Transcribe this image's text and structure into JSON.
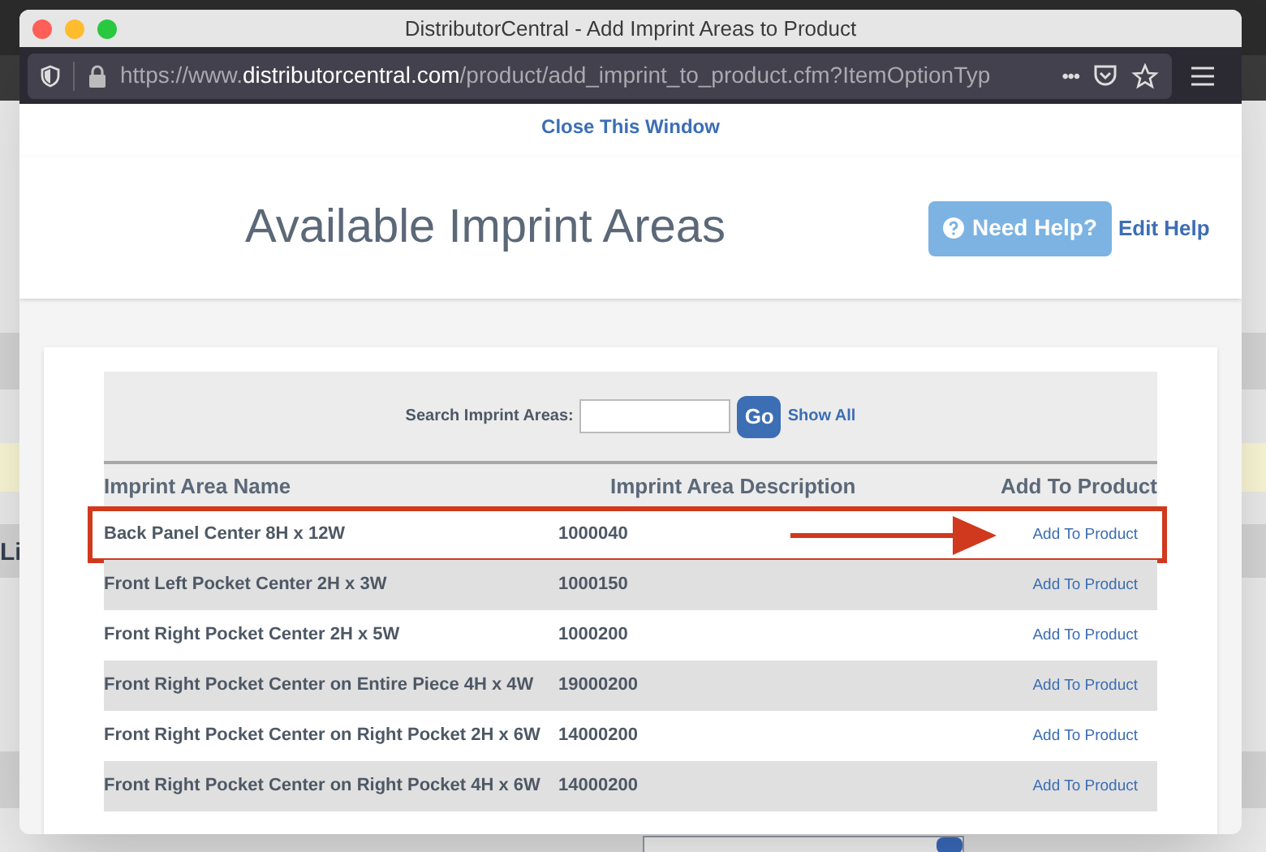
{
  "background_page": {
    "fragment": "Li"
  },
  "window": {
    "title": "DistributorCentral - Add Imprint Areas to Product"
  },
  "address_bar": {
    "url_prefix": "https://www.",
    "url_domain": "distributorcentral.com",
    "url_path": "/product/add_imprint_to_product.cfm?ItemOptionTyp",
    "more": "•••"
  },
  "close_link": "Close This Window",
  "header": {
    "title": "Available Imprint Areas",
    "help_button": "Need Help?",
    "edit_help": "Edit Help"
  },
  "search": {
    "label": "Search Imprint Areas:",
    "go": "Go",
    "show_all": "Show All"
  },
  "table": {
    "columns": [
      "Imprint Area Name",
      "Imprint Area Description",
      "Add To Product"
    ],
    "rows": [
      {
        "name": "Back Panel Center 8H x 12W",
        "description": "1000040",
        "action": "Add To Product",
        "highlighted": true
      },
      {
        "name": "Front Left Pocket Center 2H x 3W",
        "description": "1000150",
        "action": "Add To Product",
        "highlighted": false
      },
      {
        "name": "Front Right Pocket Center 2H x 5W",
        "description": "1000200",
        "action": "Add To Product",
        "highlighted": false
      },
      {
        "name": "Front Right Pocket Center on Entire Piece 4H x 4W",
        "description": "19000200",
        "action": "Add To Product",
        "highlighted": false
      },
      {
        "name": "Front Right Pocket Center on Right Pocket 2H x 6W",
        "description": "14000200",
        "action": "Add To Product",
        "highlighted": false
      },
      {
        "name": "Front Right Pocket Center on Right Pocket 4H x 6W",
        "description": "14000200",
        "action": "Add To Product",
        "highlighted": false
      }
    ]
  }
}
